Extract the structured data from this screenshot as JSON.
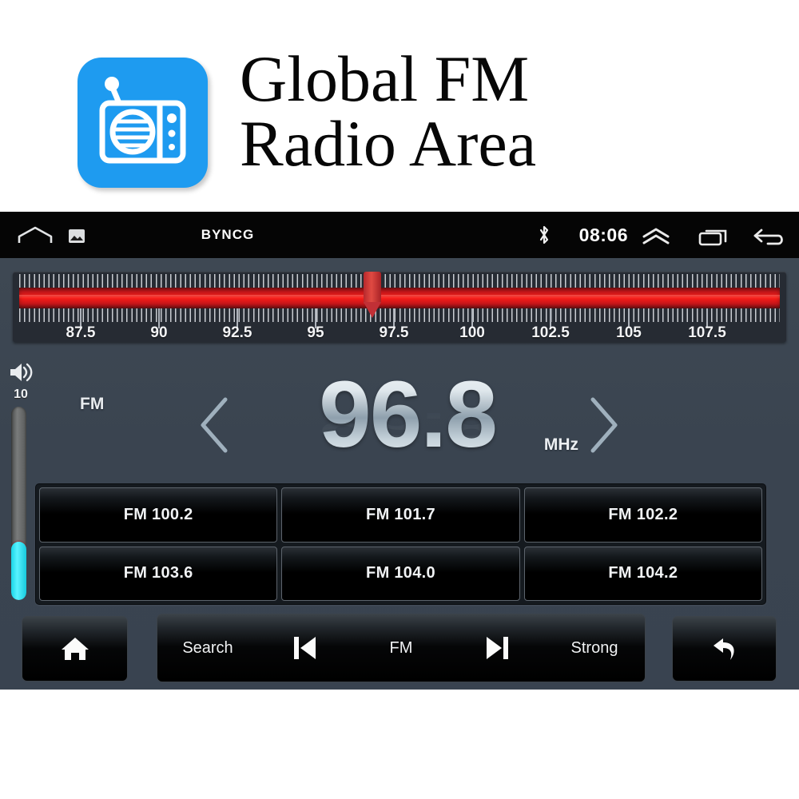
{
  "banner": {
    "icon_name": "radio-app-icon",
    "icon_color": "#1e9bf0",
    "title_line1": "Global FM",
    "title_line2": "Radio Area"
  },
  "statusbar": {
    "home_icon": "home-icon",
    "photo_icon": "photo-icon",
    "brand": "BYNCG",
    "bluetooth_icon": "bluetooth-icon",
    "time": "08:06",
    "expand_icon": "chevron-up-double-icon",
    "recents_icon": "recent-apps-icon",
    "back_icon": "back-arrow-icon"
  },
  "tuner": {
    "labels": [
      "87.5",
      "90",
      "92.5",
      "95",
      "97.5",
      "100",
      "102.5",
      "105",
      "107.5"
    ],
    "min": 87.5,
    "max": 108.0,
    "needle_value": 96.8,
    "band_color": "#fa1c17"
  },
  "volume": {
    "icon": "speaker-volume-icon",
    "value": "10",
    "fill_percent": 30,
    "fill_color": "#2fe4f2"
  },
  "display": {
    "band": "FM",
    "frequency": "96.8",
    "unit": "MHz",
    "prev_icon": "chevron-left-icon",
    "next_icon": "chevron-right-icon"
  },
  "presets": [
    {
      "label": "FM 100.2"
    },
    {
      "label": "FM 101.7"
    },
    {
      "label": "FM 102.2"
    },
    {
      "label": "FM 103.6"
    },
    {
      "label": "FM 104.0"
    },
    {
      "label": "FM 104.2"
    }
  ],
  "toolbar": {
    "home_icon": "home-filled-icon",
    "search_label": "Search",
    "prev_icon": "skip-previous-icon",
    "band_label": "FM",
    "next_icon": "skip-next-icon",
    "strong_label": "Strong",
    "back_icon": "undo-arrow-icon"
  }
}
